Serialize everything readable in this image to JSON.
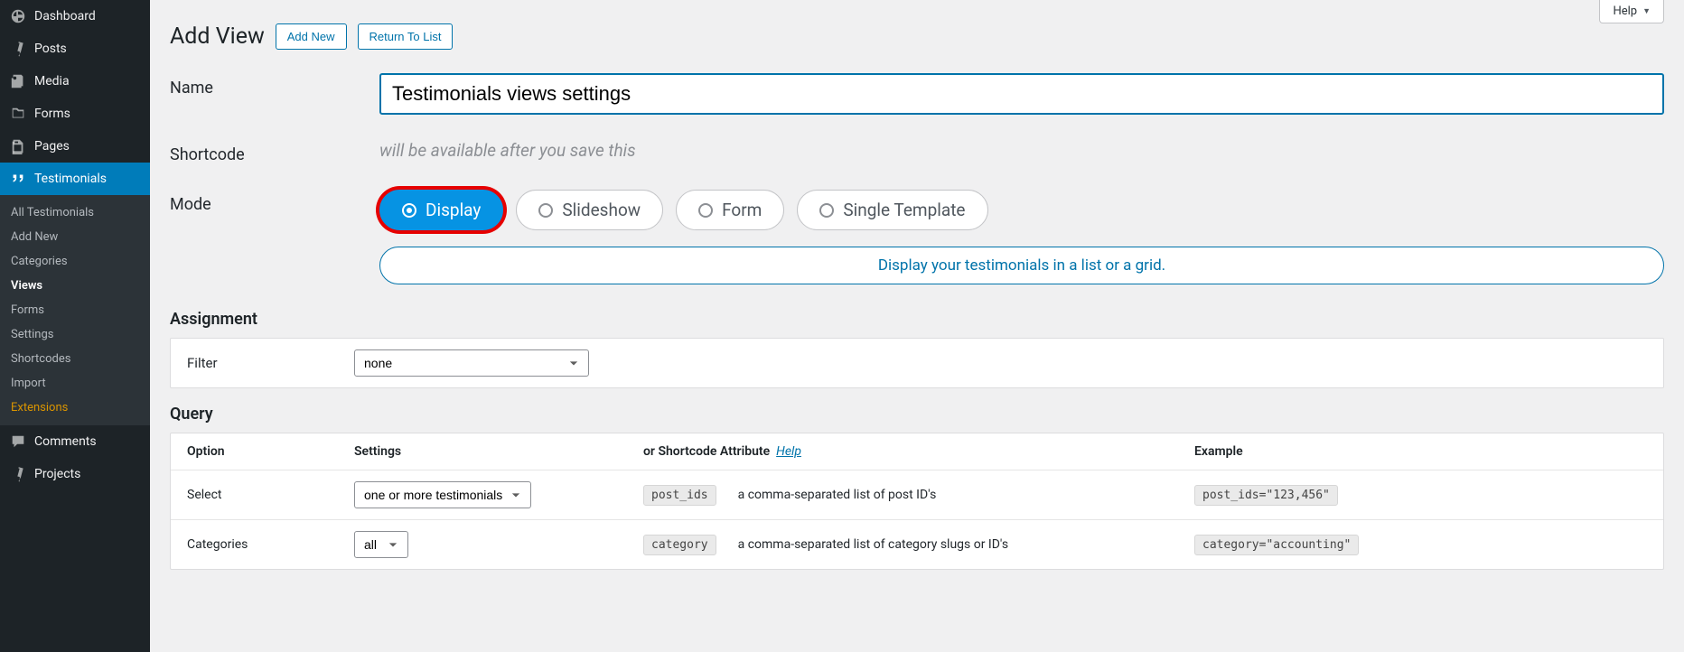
{
  "sidebar": {
    "items": [
      {
        "label": "Dashboard",
        "icon": "dashboard"
      },
      {
        "label": "Posts",
        "icon": "pin"
      },
      {
        "label": "Media",
        "icon": "media"
      },
      {
        "label": "Forms",
        "icon": "forms"
      },
      {
        "label": "Pages",
        "icon": "pages"
      },
      {
        "label": "Testimonials",
        "icon": "quote"
      },
      {
        "label": "Comments",
        "icon": "comment"
      },
      {
        "label": "Projects",
        "icon": "pin"
      }
    ],
    "sub": [
      {
        "label": "All Testimonials"
      },
      {
        "label": "Add New"
      },
      {
        "label": "Categories"
      },
      {
        "label": "Views"
      },
      {
        "label": "Forms"
      },
      {
        "label": "Settings"
      },
      {
        "label": "Shortcodes"
      },
      {
        "label": "Import"
      },
      {
        "label": "Extensions"
      }
    ]
  },
  "header": {
    "help": "Help",
    "title": "Add View",
    "add_new": "Add New",
    "return": "Return To List"
  },
  "form": {
    "name_label": "Name",
    "name_value": "Testimonials views settings",
    "shortcode_label": "Shortcode",
    "shortcode_note": "will be available after you save this",
    "mode_label": "Mode",
    "modes": [
      {
        "label": "Display"
      },
      {
        "label": "Slideshow"
      },
      {
        "label": "Form"
      },
      {
        "label": "Single Template"
      }
    ],
    "mode_desc": "Display your testimonials in a list or a grid."
  },
  "assignment": {
    "title": "Assignment",
    "filter_label": "Filter",
    "filter_value": "none"
  },
  "query": {
    "title": "Query",
    "head": {
      "option": "Option",
      "settings": "Settings",
      "attr": "or Shortcode Attribute",
      "help": "Help",
      "example": "Example"
    },
    "rows": [
      {
        "option": "Select",
        "setting": "one or more testimonials",
        "code": "post_ids",
        "desc": "a comma-separated list of post ID's",
        "example": "post_ids=\"123,456\""
      },
      {
        "option": "Categories",
        "setting": "all",
        "code": "category",
        "desc": "a comma-separated list of category slugs or ID's",
        "example": "category=\"accounting\""
      }
    ]
  }
}
